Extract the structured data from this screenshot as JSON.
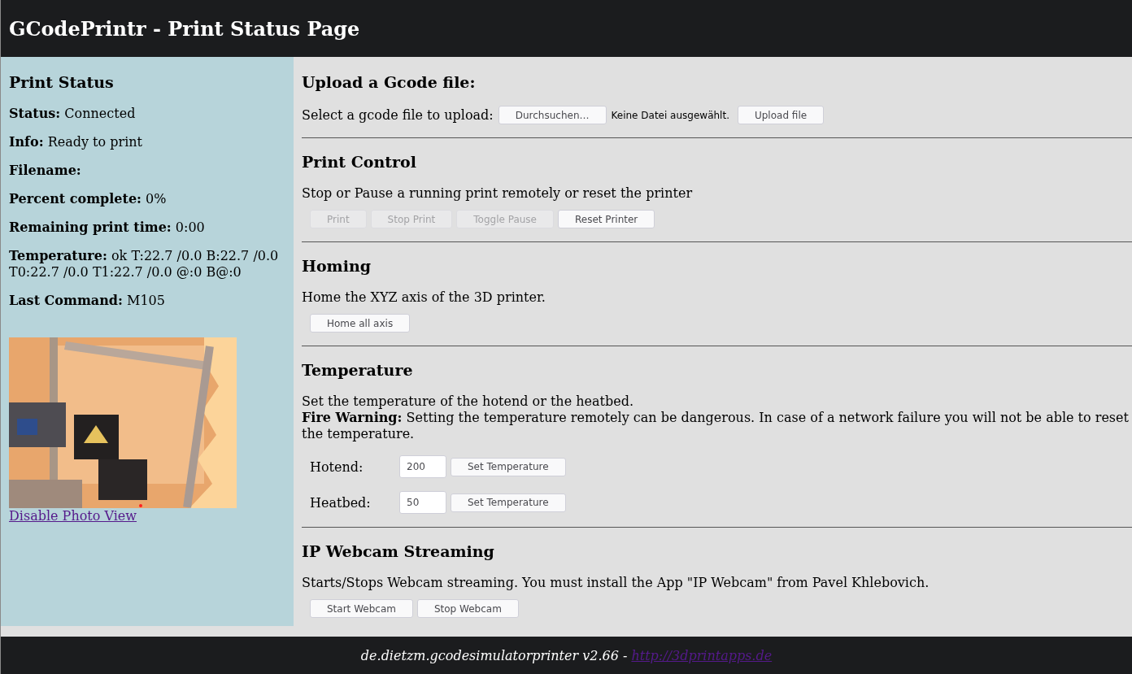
{
  "header": {
    "title": "GCodePrintr - Print Status Page"
  },
  "sidebar": {
    "heading": "Print Status",
    "fields": [
      {
        "label": "Status:",
        "value": "Connected"
      },
      {
        "label": "Info:",
        "value": "Ready to print"
      },
      {
        "label": "Filename:"
      },
      {
        "label": "Percent complete:",
        "value": "0%"
      },
      {
        "label": "Remaining print time:",
        "value": "0:00"
      },
      {
        "label": "Temperature:",
        "value": "ok T:22.7 /0.0 B:22.7 /0.0 T0:22.7 /0.0 T1:22.7 /0.0 @:0 B@:0"
      },
      {
        "label": "Last Command:",
        "value": "M105"
      }
    ],
    "link": "Disable Photo View"
  },
  "sections": [
    {
      "kind": "upload",
      "heading": "Upload a Gcode file:",
      "prompt": "Select a gcode file to upload:",
      "browse_button": "Durchsuchen…",
      "file_status": "Keine Datei ausgewählt.",
      "upload_button": "Upload file"
    },
    {
      "kind": "buttons",
      "heading": "Print Control",
      "description": "Stop or Pause a running print remotely or reset the printer",
      "buttons": [
        {
          "label": "Print",
          "disabled": true
        },
        {
          "label": "Stop Print",
          "disabled": true
        },
        {
          "label": "Toggle Pause",
          "disabled": true
        },
        {
          "label": "Reset Printer",
          "disabled": false
        }
      ]
    },
    {
      "kind": "buttons",
      "heading": "Homing",
      "description": "Home the XYZ axis of the 3D printer.",
      "buttons": [
        {
          "label": "Home all axis",
          "disabled": false
        }
      ]
    },
    {
      "kind": "temperature",
      "heading": "Temperature",
      "description": "Set the temperature of the hotend or the heatbed.",
      "warning": "**Fire Warning:** Setting the temperature remotely can be dangerous. In case of a network failure you will not be able to reset the temperature.",
      "rows": [
        {
          "label": "Hotend:",
          "value": "200",
          "button": "Set Temperature"
        },
        {
          "label": "Heatbed:",
          "value": "50",
          "button": "Set Temperature"
        }
      ]
    },
    {
      "kind": "buttons",
      "heading": "IP Webcam Streaming",
      "description": "Starts/Stops Webcam streaming. You must install the App \"IP Webcam\" from Pavel Khlebovich.",
      "buttons": [
        {
          "label": "Start Webcam",
          "disabled": false
        },
        {
          "label": "Stop Webcam",
          "disabled": false
        }
      ]
    }
  ],
  "footer": {
    "text": "de.dietzm.gcodesimulatorprinter v2.66 -",
    "link": "http://3dprintapps.de"
  }
}
